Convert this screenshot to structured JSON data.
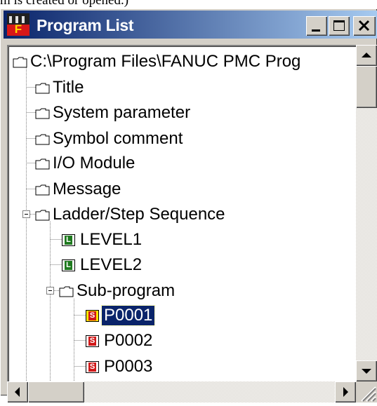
{
  "caption": "m is created or opened.)",
  "window": {
    "title": "Program List",
    "controls": [
      "minimize-icon",
      "maximize-icon",
      "close-icon"
    ]
  },
  "tree": {
    "root": "C:\\Program Files\\FANUC PMC Prog",
    "items": [
      {
        "label": "Title",
        "icon": "folder-icon"
      },
      {
        "label": "System parameter",
        "icon": "folder-icon"
      },
      {
        "label": "Symbol comment",
        "icon": "folder-icon"
      },
      {
        "label": "I/O Module",
        "icon": "folder-icon"
      },
      {
        "label": "Message",
        "icon": "folder-icon"
      },
      {
        "label": "Ladder/Step Sequence",
        "icon": "folder-open-icon",
        "expanded": true
      },
      {
        "label": "LEVEL1",
        "icon": "ladder-level-icon"
      },
      {
        "label": "LEVEL2",
        "icon": "ladder-level-icon"
      },
      {
        "label": "Sub-program",
        "icon": "folder-open-icon",
        "expanded": true
      },
      {
        "label": "P0001",
        "icon": "sub-program-icon",
        "selected": true
      },
      {
        "label": "P0002",
        "icon": "sub-program-icon"
      },
      {
        "label": "P0003",
        "icon": "sub-program-icon"
      }
    ]
  },
  "icon_glyphs": {
    "ladder": "L",
    "sub": "S"
  },
  "colors": {
    "titlebar_start": "#0a246a",
    "titlebar_end": "#a6caf0",
    "selection": "#0a246a",
    "face": "#d4d0c8"
  }
}
